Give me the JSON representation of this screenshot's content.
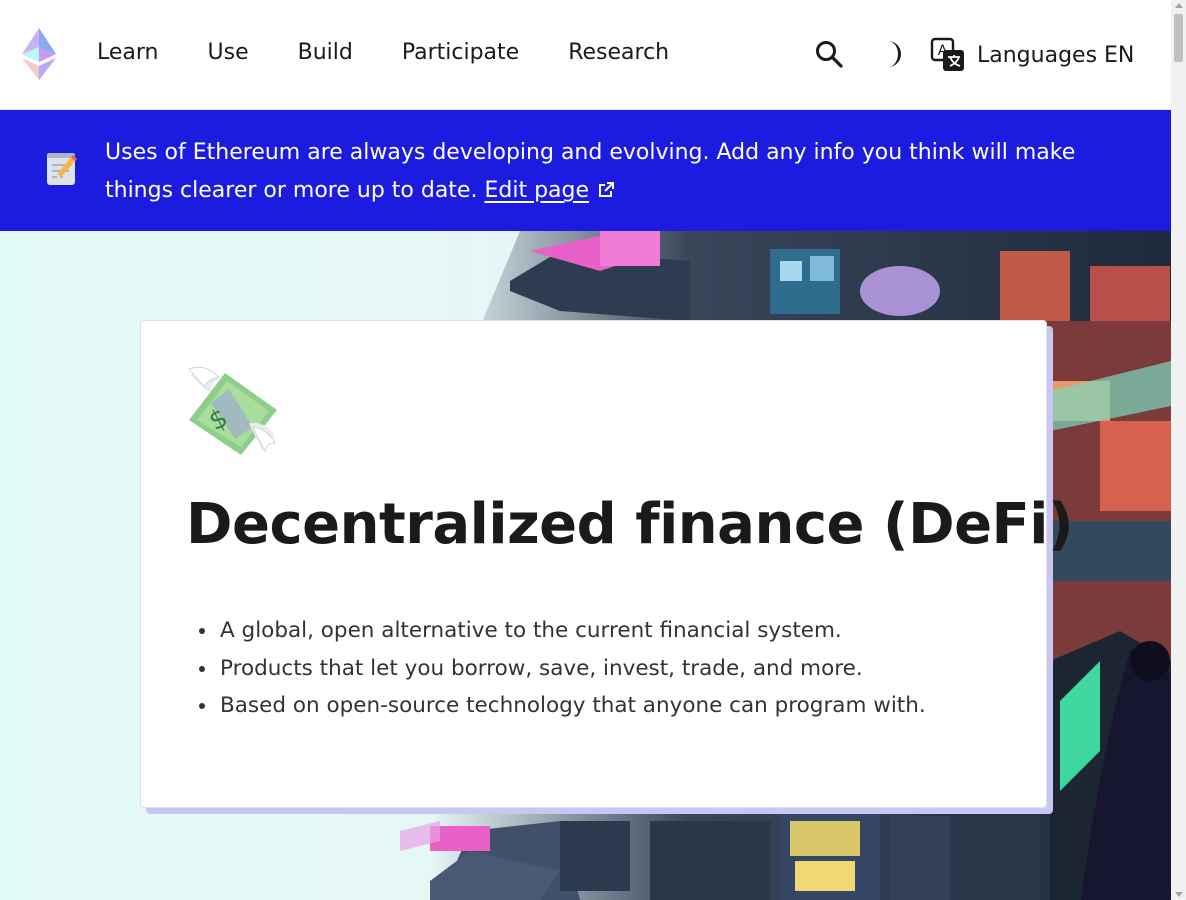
{
  "nav": {
    "logo": "ethereum-logo",
    "links": [
      "Learn",
      "Use",
      "Build",
      "Participate",
      "Research"
    ],
    "search_icon": "search-icon",
    "theme_icon": "moon-icon",
    "language_label": "Languages EN"
  },
  "banner": {
    "icon": "memo-icon",
    "text": "Uses of Ethereum are always developing and evolving. Add any info you think will make things clearer or more up to date.",
    "link_label": "Edit page",
    "background": "#1c1ce1"
  },
  "hero": {
    "emoji": "money-with-wings-icon",
    "title": "Decentralized finance (DeFi)",
    "points": [
      "A global, open alternative to the current financial system.",
      "Products that let you borrow, save, invest, trade, and more.",
      "Based on open-source technology that anyone can program with."
    ]
  }
}
